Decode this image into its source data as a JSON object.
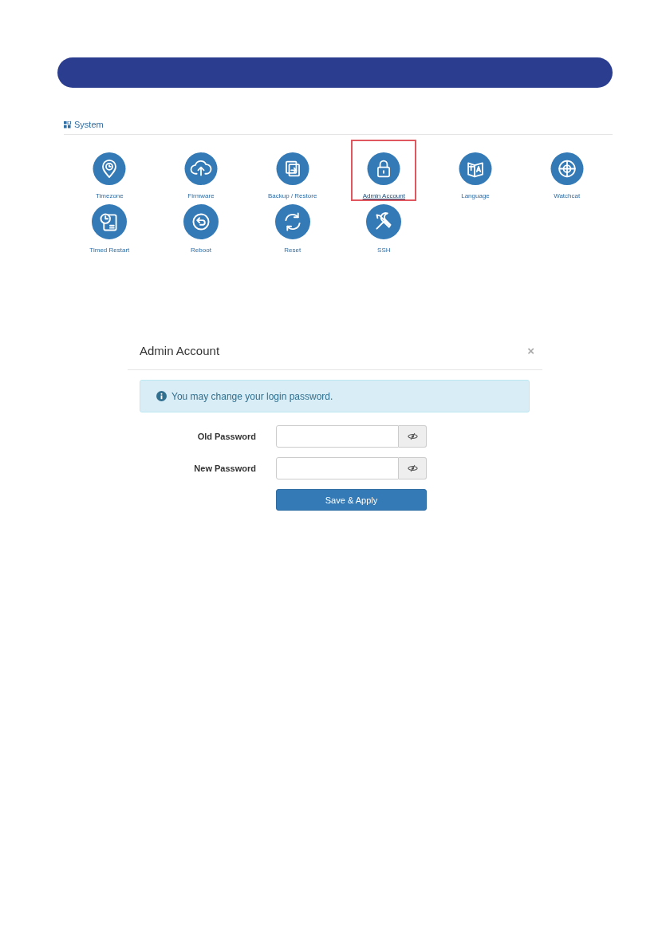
{
  "section": {
    "title": "System"
  },
  "tiles": [
    {
      "label": "Timezone",
      "kind": "pin",
      "selected": false
    },
    {
      "label": "Firmware",
      "kind": "cloud",
      "selected": false
    },
    {
      "label": "Backup / Restore",
      "kind": "swap",
      "selected": false
    },
    {
      "label": "Admin Account",
      "kind": "lock",
      "selected": true
    },
    {
      "label": "Language",
      "kind": "translate",
      "selected": false
    },
    {
      "label": "Watchcat",
      "kind": "target",
      "selected": false
    },
    {
      "label": "Timed Restart",
      "kind": "schedule",
      "selected": false
    },
    {
      "label": "Reboot",
      "kind": "reboot",
      "selected": false
    },
    {
      "label": "Reset",
      "kind": "refresh",
      "selected": false
    },
    {
      "label": "SSH",
      "kind": "tools",
      "selected": false
    }
  ],
  "dialog": {
    "title": "Admin Account",
    "close": "×",
    "alert": "You may change your login password.",
    "fields": [
      {
        "label": "Old Password"
      },
      {
        "label": "New Password"
      }
    ],
    "button": "Save & Apply"
  }
}
